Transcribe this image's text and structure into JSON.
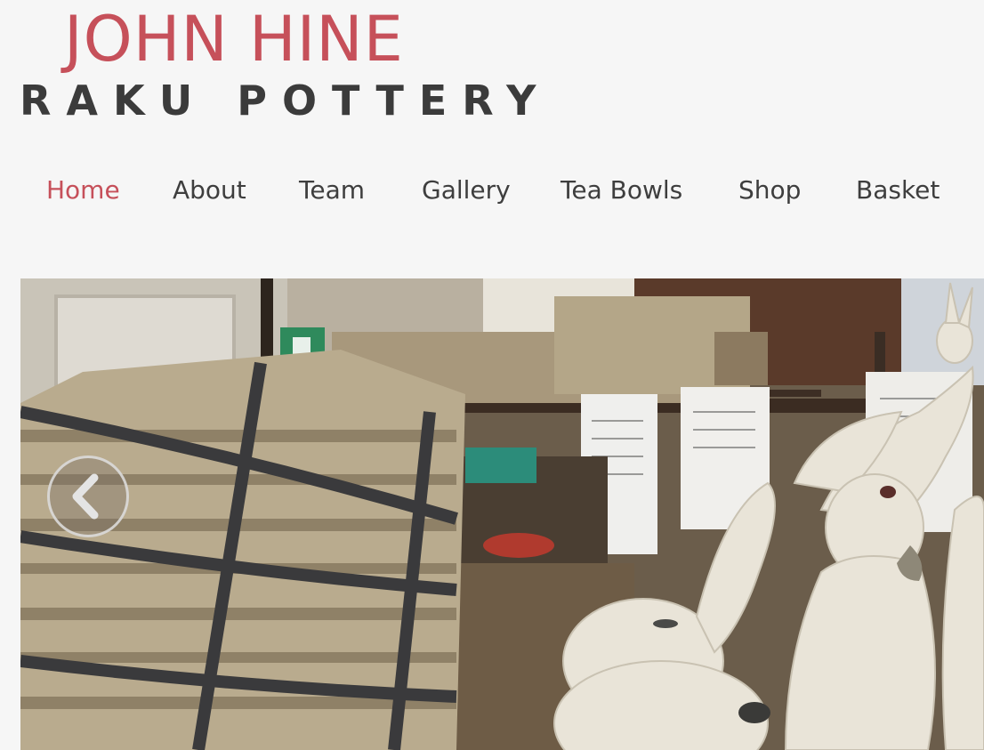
{
  "logo": {
    "line1": "JOHN HINE",
    "line2": "RAKU POTTERY",
    "primary_color": "#c6505a",
    "secondary_color": "#3b3b3b"
  },
  "nav": {
    "items": [
      {
        "label": "Home",
        "active": true
      },
      {
        "label": "About",
        "active": false
      },
      {
        "label": "Team",
        "active": false
      },
      {
        "label": "Gallery",
        "active": false
      },
      {
        "label": "Tea Bowls",
        "active": false
      },
      {
        "label": "Shop",
        "active": false
      },
      {
        "label": "Basket",
        "active": false
      }
    ],
    "active_color": "#c6505a",
    "text_color": "#3e3e3e"
  },
  "hero": {
    "prev_icon": "chevron-left-icon"
  }
}
